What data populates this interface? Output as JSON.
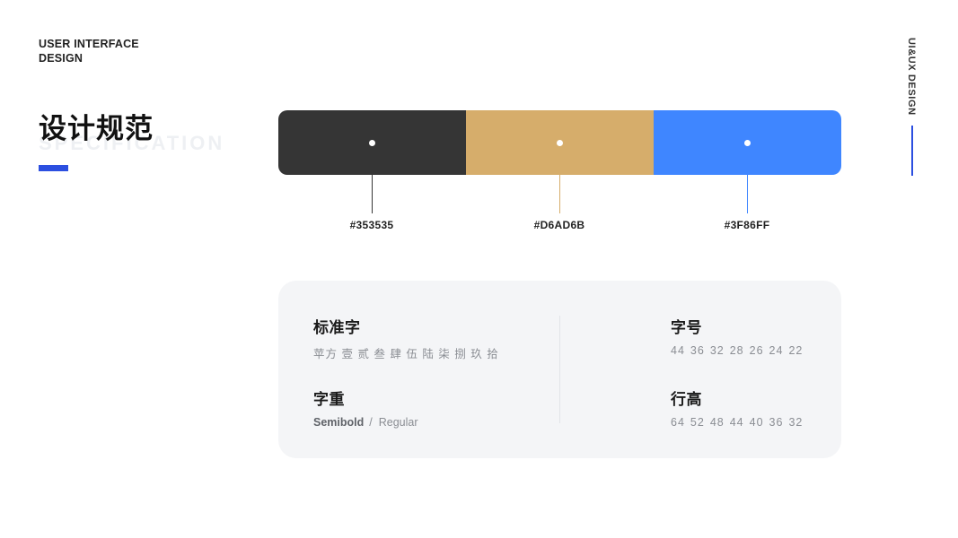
{
  "brand": {
    "line1": "USER INTERFACE",
    "line2": "DESIGN"
  },
  "side_label": "UI&UX DESIGN",
  "title": {
    "main": "设计规范",
    "ghost": "SPECIFICATION"
  },
  "palette": [
    {
      "hex": "#353535",
      "label": "#353535"
    },
    {
      "hex": "#D6AD6B",
      "label": "#D6AD6B"
    },
    {
      "hex": "#3F86FF",
      "label": "#3F86FF"
    }
  ],
  "typography": {
    "font": {
      "heading": "标准字",
      "value": "苹方  壹 贰 叁 肆 伍 陆 柒 捌 玖 拾"
    },
    "weight": {
      "heading": "字重",
      "bold": "Semibold",
      "separator": "/",
      "regular": "Regular"
    },
    "sizes": {
      "heading": "字号",
      "values": [
        "44",
        "36",
        "32",
        "28",
        "26",
        "24",
        "22"
      ]
    },
    "line_heights": {
      "heading": "行高",
      "values": [
        "64",
        "52",
        "48",
        "44",
        "40",
        "36",
        "32"
      ]
    }
  },
  "colors": {
    "accent": "#2C4FE0",
    "card_bg": "#F4F5F7"
  }
}
